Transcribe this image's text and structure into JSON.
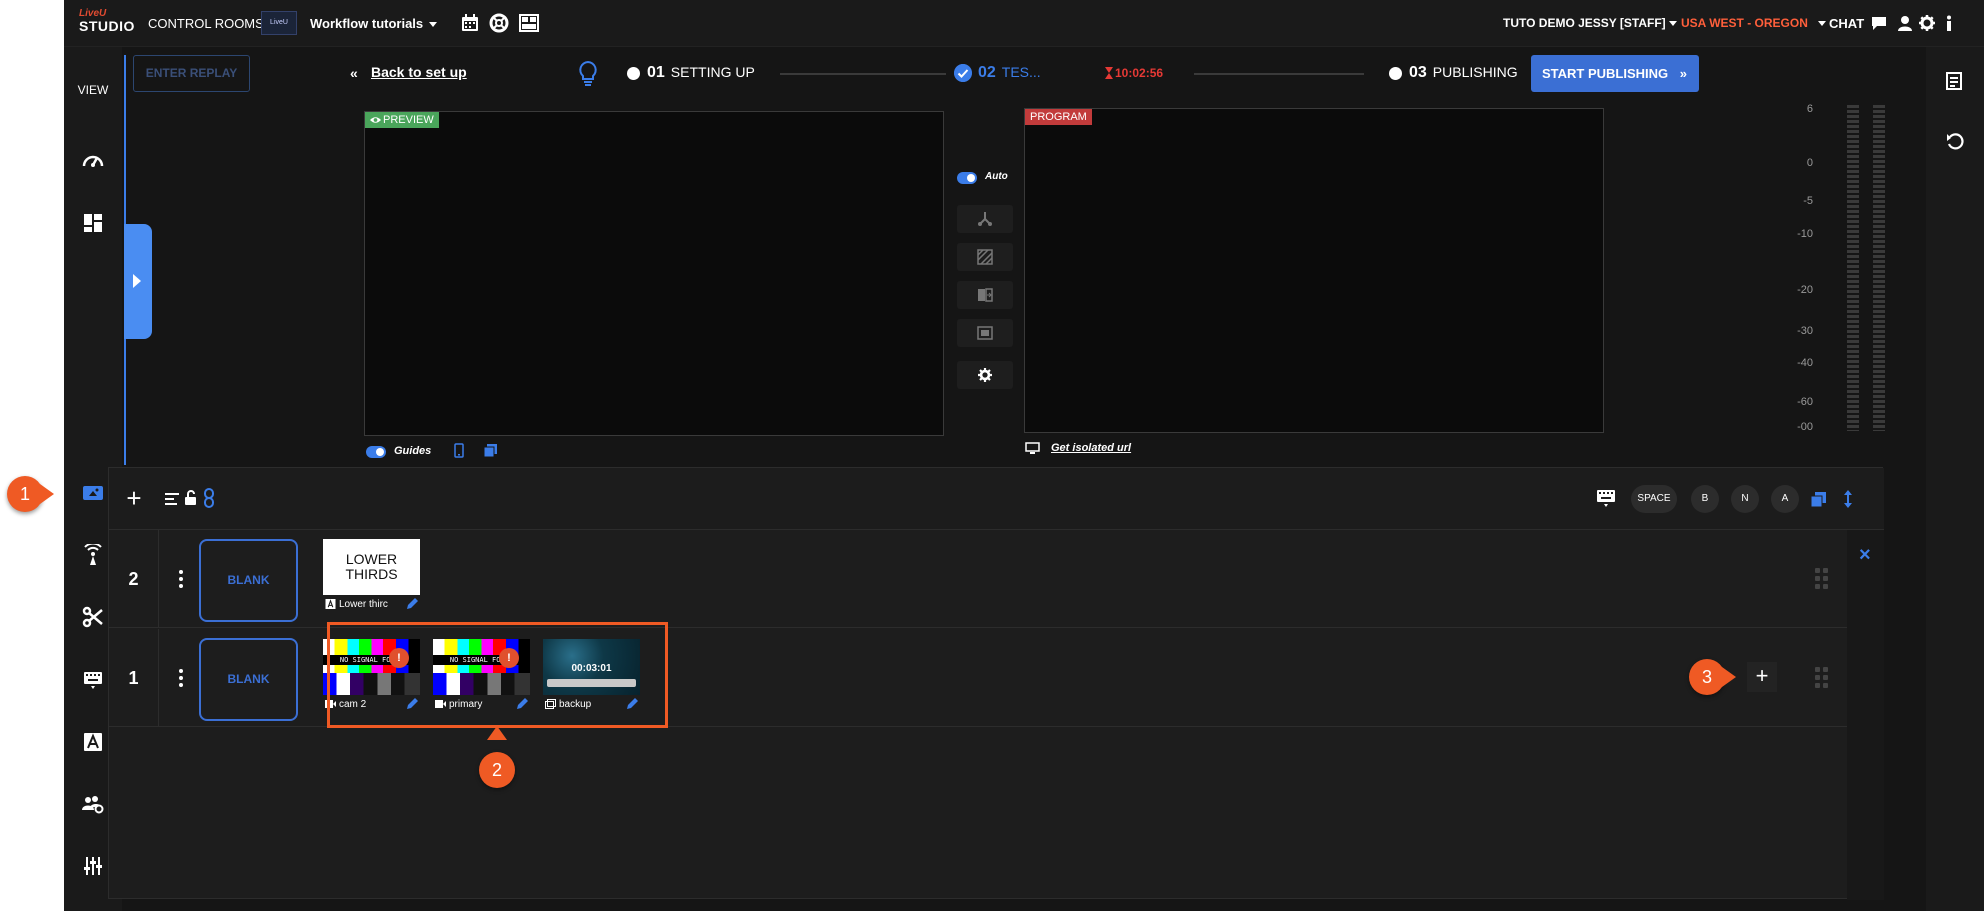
{
  "topbar": {
    "logo_line1": "LiveU",
    "logo_line2": "STUDIO",
    "control_rooms": "CONTROL ROOMS",
    "workflow_thumb": "LiveU",
    "workflow_name": "Workflow tutorials",
    "account": "TUTO DEMO JESSY [STAFF]",
    "region": "USA WEST - OREGON",
    "chat": "CHAT",
    "icons": [
      "calendar-icon",
      "lifebuoy-icon",
      "layout-icon",
      "chat-bubble-icon",
      "user-icon",
      "gear-icon",
      "info-icon"
    ]
  },
  "sidebar": {
    "view_label": "VIEW",
    "items": [
      "dashboard-icon",
      "layout-grid-icon",
      "video-camera-icon",
      "broadcast-icon",
      "scissors-icon",
      "keyboard-icon",
      "text-icon",
      "users-gear-icon",
      "sliders-icon"
    ]
  },
  "header": {
    "replay": "ENTER REPLAY",
    "back": "Back to set up",
    "back_chevron": "«",
    "step1_num": "01",
    "step1_label": "SETTING UP",
    "step2_num": "02",
    "step2_label": "TES...",
    "timer": "10:02:56",
    "step3_num": "03",
    "step3_label": "PUBLISHING",
    "start": "START PUBLISHING",
    "start_chevron": "»"
  },
  "preview": {
    "tag": "PREVIEW",
    "guides": "Guides"
  },
  "program": {
    "tag": "PROGRAM",
    "isolated": "Get isolated url"
  },
  "transitions": {
    "auto": "Auto"
  },
  "meter": {
    "labels": [
      "6",
      "0",
      "-5",
      "-10",
      "-20",
      "-30",
      "-40",
      "-60",
      "-00"
    ]
  },
  "layers": {
    "keys": [
      "SPACE",
      "B",
      "N",
      "A"
    ],
    "rows": [
      {
        "number": "2",
        "blank": "BLANK",
        "lower_title": "LOWER THIRDS",
        "lower_label": "Lower thirc"
      },
      {
        "number": "1",
        "blank": "BLANK",
        "sources": [
          {
            "label": "cam 2",
            "no_signal": "NO SIGNAL FOUND",
            "warning": "!"
          },
          {
            "label": "primary",
            "no_signal": "NO SIGNAL FOUND",
            "warning": "!"
          },
          {
            "label": "backup",
            "time": "00:03:01"
          }
        ]
      }
    ],
    "add": "+",
    "close": "×"
  },
  "annotations": [
    "1",
    "2",
    "3"
  ],
  "colors": {
    "accent": "#3b7de9",
    "annotation": "#ef5a24",
    "preview": "#4aa55b",
    "program": "#c23b3b",
    "region": "#ff5f3b",
    "timer": "#e53935"
  }
}
